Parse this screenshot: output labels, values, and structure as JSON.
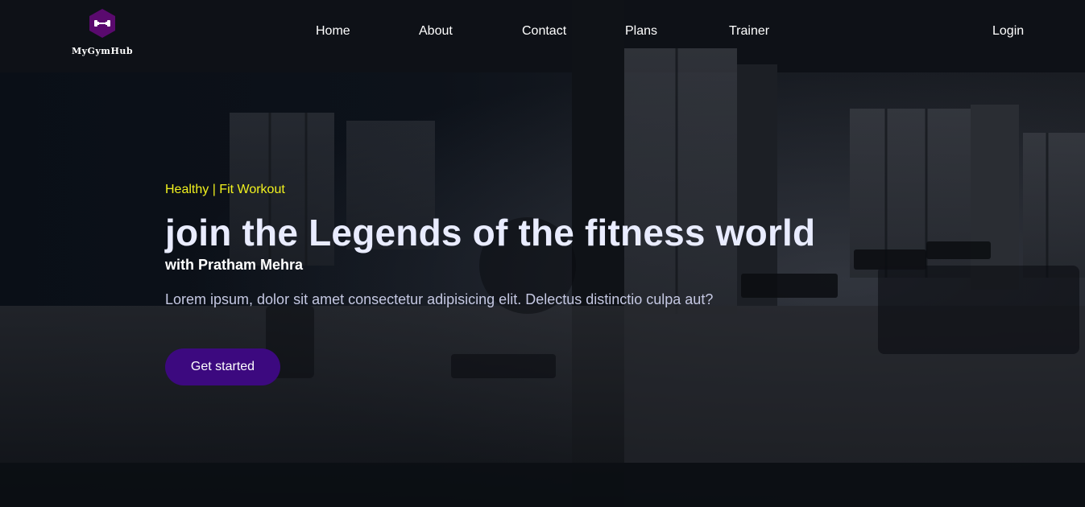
{
  "brand": {
    "name": "MyGymHub",
    "accent_color": "#5a0a6e",
    "icon": "dumbbell-icon"
  },
  "nav": {
    "items": [
      {
        "label": "Home"
      },
      {
        "label": "About"
      },
      {
        "label": "Contact"
      },
      {
        "label": "Plans"
      },
      {
        "label": "Trainer"
      }
    ],
    "login_label": "Login"
  },
  "hero": {
    "tagline": "Healthy | Fit Workout",
    "tagline_color": "#f2f21e",
    "headline": "join the Legends of the fitness world",
    "subheadline": "with Pratham Mehra",
    "description": "Lorem ipsum, dolor sit amet consectetur adipisicing elit. Delectus distinctio culpa aut?",
    "cta_label": "Get started",
    "cta_color": "#3c097f"
  }
}
